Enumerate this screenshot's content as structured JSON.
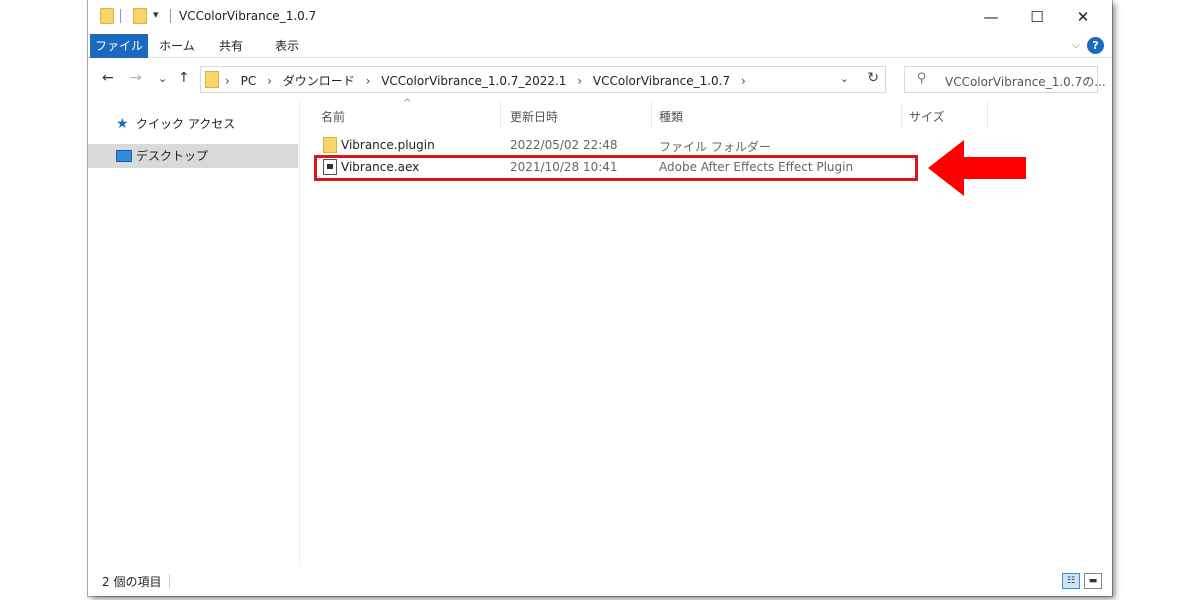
{
  "window": {
    "title": "VCColorVibrance_1.0.7",
    "quick_access_arrow": "▾",
    "buttons": {
      "minimize": "—",
      "maximize": "☐",
      "close": "✕"
    }
  },
  "ribbon": {
    "tabs": [
      "ファイル",
      "ホーム",
      "共有",
      "表示"
    ],
    "expand_glyph": "⌵",
    "help_glyph": "?"
  },
  "nav": {
    "back_glyph": "←",
    "forward_glyph": "→",
    "recent_glyph": "⌄",
    "up_glyph": "↑",
    "breadcrumb": [
      "PC",
      "ダウンロード",
      "VCColorVibrance_1.0.7_2022.1",
      "VCColorVibrance_1.0.7"
    ],
    "chevron": "›",
    "dropdown_glyph": "⌄",
    "refresh_glyph": "↻",
    "search_placeholder": "VCColorVibrance_1.0.7の..."
  },
  "sidebar": {
    "items": [
      {
        "label": "クイック アクセス",
        "icon": "star-icon"
      },
      {
        "label": "デスクトップ",
        "icon": "desktop-icon",
        "selected": true
      }
    ]
  },
  "list": {
    "sort_caret": "^",
    "columns": [
      "名前",
      "更新日時",
      "種類",
      "サイズ"
    ],
    "rows": [
      {
        "name": "Vibrance.plugin",
        "date": "2022/05/02 22:48",
        "type": "ファイル フォルダー",
        "icon": "folder-icon"
      },
      {
        "name": "Vibrance.aex",
        "date": "2021/10/28 10:41",
        "type": "Adobe After Effects Effect Plugin",
        "icon": "plugin-file-icon"
      }
    ]
  },
  "status": {
    "item_count": "2 個の項目"
  },
  "colors": {
    "accent": "#1b6ac0",
    "highlight": "#e31212",
    "arrow": "#ff0000"
  }
}
